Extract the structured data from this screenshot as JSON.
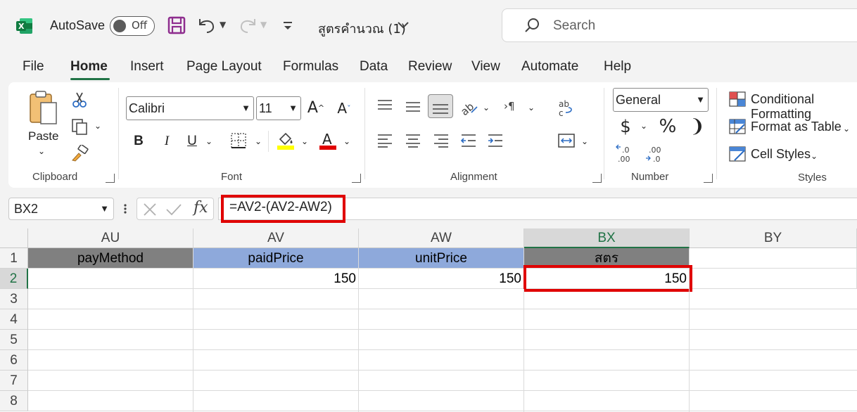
{
  "titlebar": {
    "autosave_label": "AutoSave",
    "autosave_state": "Off",
    "doc_title": "สูตรคำนวณ (1)",
    "search_placeholder": "Search"
  },
  "menu": [
    "File",
    "Home",
    "Insert",
    "Page Layout",
    "Formulas",
    "Data",
    "Review",
    "View",
    "Automate",
    "Help"
  ],
  "ribbon": {
    "clipboard": {
      "paste_label": "Paste",
      "group_label": "Clipboard"
    },
    "font": {
      "font_name": "Calibri",
      "font_size": "11",
      "group_label": "Font",
      "bold": "B",
      "italic": "I",
      "underline": "U"
    },
    "alignment": {
      "group_label": "Alignment"
    },
    "number": {
      "format": "General",
      "group_label": "Number",
      "currency": "$",
      "percent": "%",
      "comma": "❩"
    },
    "styles": {
      "conditional": "Conditional Formatting",
      "format_table": "Format as Table",
      "cell_styles": "Cell Styles",
      "group_label": "Styles"
    }
  },
  "formula_bar": {
    "name_box": "BX2",
    "formula": "=AV2-(AV2-AW2)"
  },
  "grid": {
    "columns": [
      "AU",
      "AV",
      "AW",
      "BX",
      "BY"
    ],
    "rows": [
      "1",
      "2",
      "3",
      "4",
      "5",
      "6",
      "7",
      "8"
    ],
    "headers": {
      "AU": "payMethod",
      "AV": "paidPrice",
      "AW": "unitPrice",
      "BX": "สตร"
    },
    "row2": {
      "AV": "150",
      "AW": "150",
      "BX": "150"
    },
    "header_colors": {
      "AU": "#808080",
      "AV": "#8ea9db",
      "AW": "#8ea9db",
      "BX": "#808080"
    },
    "selected_cell": "BX2"
  },
  "colors": {
    "accent": "#217346",
    "highlight": "#e00000"
  }
}
